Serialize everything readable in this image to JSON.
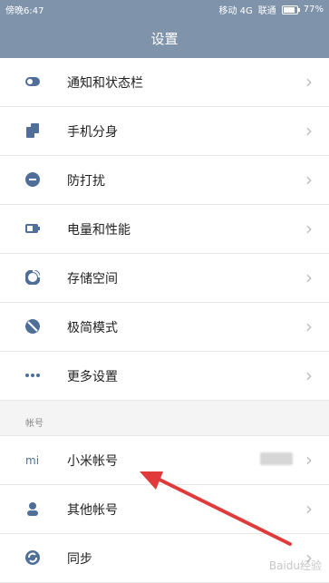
{
  "status": {
    "time": "傍晚6:47",
    "carrier1": "移动 4G",
    "carrier2": "联通",
    "battery": "77%",
    "battery_level": 0.77
  },
  "header": {
    "title": "设置"
  },
  "items_top": [
    {
      "label": "通知和状态栏",
      "icon": "toggle-icon"
    },
    {
      "label": "手机分身",
      "icon": "phone-clone-icon"
    },
    {
      "label": "防打扰",
      "icon": "do-not-disturb-icon"
    },
    {
      "label": "电量和性能",
      "icon": "battery-icon"
    },
    {
      "label": "存储空间",
      "icon": "storage-icon"
    },
    {
      "label": "极简模式",
      "icon": "minimal-mode-icon"
    },
    {
      "label": "更多设置",
      "icon": "more-dots-icon"
    }
  ],
  "account_section": {
    "caption": "帐号",
    "items": [
      {
        "label": "小米帐号",
        "icon": "mi-icon"
      },
      {
        "label": "其他帐号",
        "icon": "person-icon"
      },
      {
        "label": "同步",
        "icon": "sync-icon"
      }
    ]
  },
  "watermark": "Baidu经验"
}
